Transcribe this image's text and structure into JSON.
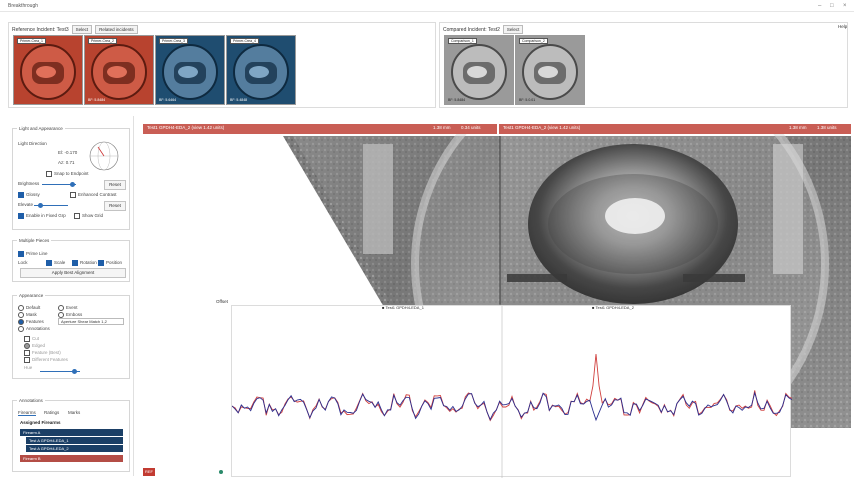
{
  "window": {
    "title": "Breakthrough"
  },
  "reference": {
    "label": "Reference Incident: Test3",
    "select_label": "Select",
    "related_label": "Related incidents",
    "thumbnails": [
      {
        "label": "Primer-Crea_1",
        "footer": "",
        "tint": "red"
      },
      {
        "label": "Primer-Crea_2",
        "footer": "BF: 5.8484",
        "tint": "red"
      },
      {
        "label": "Primer-Crea_3",
        "footer": "BF: 5.6464",
        "tint": "blue"
      },
      {
        "label": "Primer-Crea_4",
        "footer": "BF: 5.4848",
        "tint": "blue"
      }
    ]
  },
  "compared": {
    "label": "Compared Incident: Test2",
    "select_label": "Select",
    "thumbnails": [
      {
        "label": "Comparison_1",
        "footer": "BF: 5.8484",
        "tint": "gray"
      },
      {
        "label": "Comparison_2",
        "footer": "BF: 5.0.01",
        "tint": "gray"
      }
    ]
  },
  "help_label": "Help",
  "left_panel": {
    "light": {
      "title": "Light and Appearance",
      "direction_label": "Light Direction",
      "el_label": "El: -0.170",
      "az_label": "Az: 0.71",
      "snap_label": "Snap to Endpoint",
      "brightness_label": "Brightness",
      "reset_label": "Reset",
      "glossy_label": "Glossy",
      "enhanced_label": "Enhanced Contrast",
      "elevate_label": "Elevate",
      "reset2_label": "Reset",
      "enable_label": "Enable in Fixed Grp",
      "show_grid_label": "Show Grid"
    },
    "multiple_pieces": {
      "title": "Multiple Pieces",
      "primitive_label": "Prime Line",
      "lock_label": "Lock",
      "scale_label": "Scale",
      "rotation_label": "Rotation",
      "position_label": "Position",
      "apply_label": "Apply Best Alignment"
    },
    "appearance": {
      "title": "Appearance",
      "default_label": "Default",
      "event_label": "Event",
      "mask_label": "Mask",
      "emboss_label": "Emboss",
      "features_label": "Features",
      "features_value": "Aperture Shear Match 1,2",
      "annotations_label": "Annotations",
      "sub1": "Cut",
      "sub2": "Edged",
      "sub3": "Feature (Best)",
      "sub4": "Different Features",
      "sub5": "Hue"
    },
    "annotations": {
      "title": "Annotations",
      "tabs": [
        "Firearms",
        "Ratings",
        "Marks"
      ],
      "tree_header": "Assigned Firearms",
      "items": [
        "Firearm A",
        "Test A GPDH4-EDA_1",
        "Test A GPDH4-EDA_2",
        "Firearm B"
      ]
    }
  },
  "viewer": {
    "left_header": "Test1 GPDH4-EDA_2 (view 1.42 units)",
    "left_scale": "1.38 mm",
    "left_scale2": "0.34 units",
    "right_header": "Test1 GPDH4-EDA_2 (view 1.42 units)",
    "right_scale": "1.38 mm",
    "right_scale2": "1.38 units",
    "badge": "REF"
  },
  "profile": {
    "label": "Offset",
    "legend_a": "Test1 GPDH4-EDA_1",
    "legend_b": "Test1 GPDH4-EDA_2",
    "colors": {
      "a": "#2b2f8f",
      "b": "#d0403e"
    }
  }
}
